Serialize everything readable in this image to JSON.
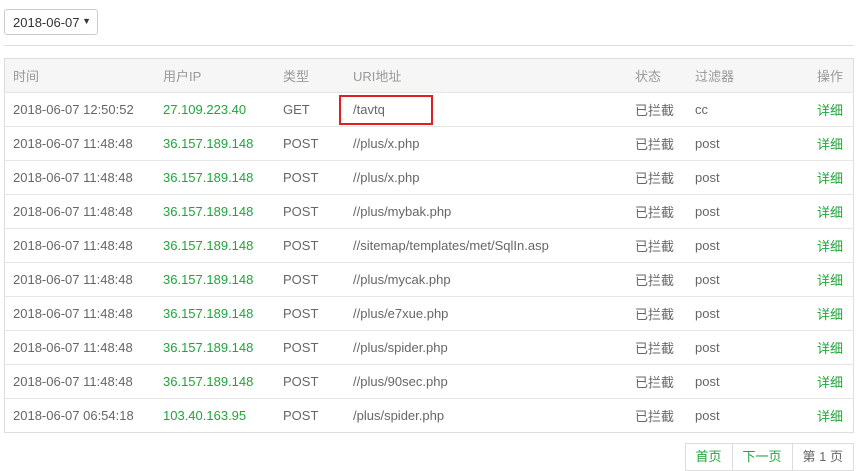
{
  "filter": {
    "date_value": "2018-06-07",
    "arrow": "▼"
  },
  "table": {
    "headers": {
      "time": "时间",
      "ip": "用户IP",
      "type": "类型",
      "uri": "URI地址",
      "status": "状态",
      "filter": "过滤器",
      "action": "操作"
    },
    "rows": [
      {
        "time": "2018-06-07 12:50:52",
        "ip": "27.109.223.40",
        "type": "GET",
        "uri": "/tavtq",
        "status": "已拦截",
        "filter": "cc",
        "action": "详细"
      },
      {
        "time": "2018-06-07 11:48:48",
        "ip": "36.157.189.148",
        "type": "POST",
        "uri": "//plus/x.php",
        "status": "已拦截",
        "filter": "post",
        "action": "详细"
      },
      {
        "time": "2018-06-07 11:48:48",
        "ip": "36.157.189.148",
        "type": "POST",
        "uri": "//plus/x.php",
        "status": "已拦截",
        "filter": "post",
        "action": "详细"
      },
      {
        "time": "2018-06-07 11:48:48",
        "ip": "36.157.189.148",
        "type": "POST",
        "uri": "//plus/mybak.php",
        "status": "已拦截",
        "filter": "post",
        "action": "详细"
      },
      {
        "time": "2018-06-07 11:48:48",
        "ip": "36.157.189.148",
        "type": "POST",
        "uri": "//sitemap/templates/met/SqlIn.asp",
        "status": "已拦截",
        "filter": "post",
        "action": "详细"
      },
      {
        "time": "2018-06-07 11:48:48",
        "ip": "36.157.189.148",
        "type": "POST",
        "uri": "//plus/mycak.php",
        "status": "已拦截",
        "filter": "post",
        "action": "详细"
      },
      {
        "time": "2018-06-07 11:48:48",
        "ip": "36.157.189.148",
        "type": "POST",
        "uri": "//plus/e7xue.php",
        "status": "已拦截",
        "filter": "post",
        "action": "详细"
      },
      {
        "time": "2018-06-07 11:48:48",
        "ip": "36.157.189.148",
        "type": "POST",
        "uri": "//plus/spider.php",
        "status": "已拦截",
        "filter": "post",
        "action": "详细"
      },
      {
        "time": "2018-06-07 11:48:48",
        "ip": "36.157.189.148",
        "type": "POST",
        "uri": "//plus/90sec.php",
        "status": "已拦截",
        "filter": "post",
        "action": "详细"
      },
      {
        "time": "2018-06-07 06:54:18",
        "ip": "103.40.163.95",
        "type": "POST",
        "uri": "/plus/spider.php",
        "status": "已拦截",
        "filter": "post",
        "action": "详细"
      }
    ]
  },
  "pagination": {
    "first": "首页",
    "next": "下一页",
    "current": "第 1 页"
  },
  "colors": {
    "accent": "#20a53a",
    "highlight_border": "#e02020"
  }
}
